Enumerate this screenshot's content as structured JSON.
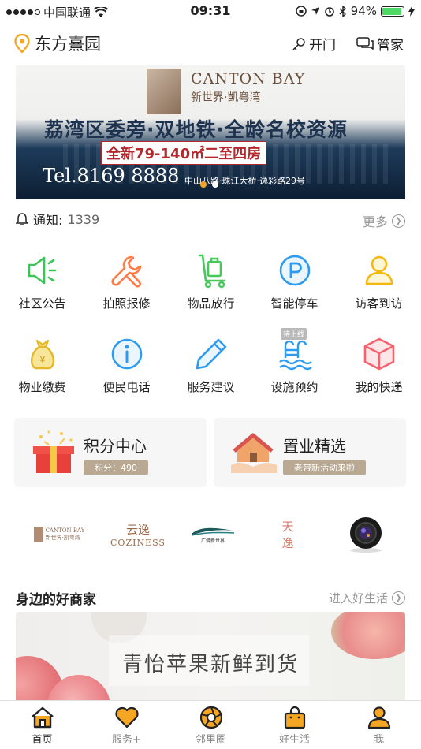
{
  "status_bar": {
    "carrier": "中国联通",
    "time": "09:31",
    "battery": "94%",
    "battery_level": 0.94
  },
  "header": {
    "community": "东方熹园",
    "open_door": "开门",
    "steward": "管家"
  },
  "banner": {
    "en_title": "CANTON BAY",
    "cn_title": "新世界·凯粤湾",
    "headline": "荔湾区委旁·双地铁·全龄名校资源",
    "subline": "全新79-140㎡二至四房",
    "tel": "Tel.8169 8888",
    "address": "中山八路·珠江大桥·逸彩路29号",
    "page_count": 2,
    "active_page": 1
  },
  "notice": {
    "label": "通知:",
    "count": "1339",
    "more": "更多"
  },
  "services": [
    {
      "label": "社区公告",
      "icon": "megaphone-icon",
      "color": "#3cc45b"
    },
    {
      "label": "拍照报修",
      "icon": "wrench-icon",
      "color": "#ff7a45"
    },
    {
      "label": "物品放行",
      "icon": "cart-icon",
      "color": "#46c85a"
    },
    {
      "label": "智能停车",
      "icon": "parking-icon",
      "color": "#2d9cf0"
    },
    {
      "label": "访客到访",
      "icon": "visitor-icon",
      "color": "#f5b80c"
    },
    {
      "label": "物业缴费",
      "icon": "money-bag-icon",
      "color": "#e3b726"
    },
    {
      "label": "便民电话",
      "icon": "info-icon",
      "color": "#2d9cf0"
    },
    {
      "label": "服务建议",
      "icon": "pencil-icon",
      "color": "#2d9cf0"
    },
    {
      "label": "设施预约",
      "icon": "pool-icon",
      "color": "#2d9cf0",
      "tag": "待上线"
    },
    {
      "label": "我的快递",
      "icon": "package-icon",
      "color": "#f5626e"
    }
  ],
  "cards": [
    {
      "title": "积分中心",
      "subtitle": "积分：490"
    },
    {
      "title": "置业精选",
      "subtitle": "老带新活动来啦"
    }
  ],
  "brands": [
    {
      "line1": "CANTON BAY",
      "line2": "新世界·凯粤湾"
    },
    {
      "line1": "云逸",
      "line2": "COZINESS"
    },
    {
      "line1": "",
      "line2": "广佛新世界"
    },
    {
      "line1": "天",
      "line2": "逸"
    },
    {
      "line1": "",
      "line2": ""
    }
  ],
  "merchants": {
    "title": "身边的好商家",
    "more": "进入好生活",
    "promo_text": "青怡苹果新鲜到货"
  },
  "tabbar": [
    {
      "label": "首页",
      "icon": "home-icon",
      "active": true
    },
    {
      "label": "服务+",
      "icon": "heart-icon",
      "active": false
    },
    {
      "label": "邻里圈",
      "icon": "aperture-icon",
      "active": false
    },
    {
      "label": "好生活",
      "icon": "shopping-bag-icon",
      "active": false
    },
    {
      "label": "我",
      "icon": "user-icon",
      "active": false
    }
  ],
  "colors": {
    "accent": "#f5a623",
    "text": "#222222",
    "muted": "#999999"
  }
}
